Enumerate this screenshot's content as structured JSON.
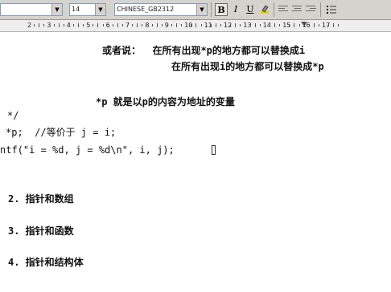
{
  "toolbar": {
    "style_value": "",
    "font_size_value": "14",
    "font_name_value": "CHINESE_GB2312",
    "bold_label": "B",
    "italic_label": "I",
    "underline_label": "U",
    "dropdown_glyph": "▼",
    "icons": [
      "bold-icon",
      "italic-icon",
      "underline-icon",
      "highlight-icon",
      "align-left-icon",
      "align-center-icon",
      "align-right-icon",
      "bullets-icon"
    ]
  },
  "ruler": {
    "numbers": [
      "2",
      "3",
      "4",
      "5",
      "6",
      "7",
      "8",
      "9",
      "10",
      "11",
      "12",
      "13",
      "14",
      "15",
      "16",
      "17"
    ]
  },
  "document": {
    "line1": "或者说：  在所有出现*p的地方都可以替换成i",
    "line2": "在所有出现i的地方都可以替换成*p",
    "line3": "*p 就是以p的内容为地址的变量",
    "line4": "*/",
    "line5": "*p;  //等价于 j = i;",
    "line6": "ntf(\"i = %d, j = %d\\n\", i, j);",
    "item2": "2. 指针和数组",
    "item3": "3. 指针和函数",
    "item4": "4. 指针和结构体"
  }
}
